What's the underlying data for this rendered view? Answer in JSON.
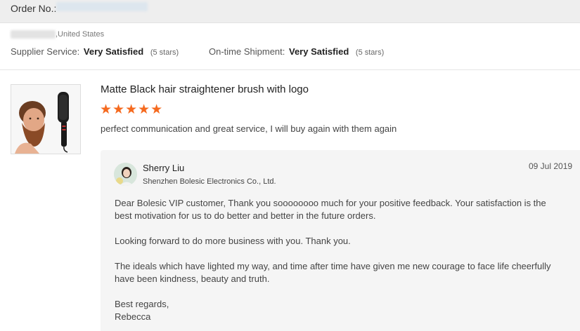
{
  "order": {
    "label": "Order No.:"
  },
  "buyer": {
    "country": ",United States"
  },
  "ratings": {
    "supplier_service": {
      "label": "Supplier Service:",
      "value": "Very Satisfied",
      "note": "(5 stars)"
    },
    "ontime_shipment": {
      "label": "On-time Shipment:",
      "value": "Very Satisfied",
      "note": "(5 stars)"
    }
  },
  "product": {
    "title": "Matte Black hair straightener brush with logo",
    "rating_stars": 5,
    "stars_text": "★★★★★",
    "feedback": "perfect communication and great service, I will buy again with them again",
    "thumbnail_icon": "man-with-hair-straightener-brush-image"
  },
  "reply": {
    "name": "Sherry Liu",
    "company": "Shenzhen Bolesic Electronics Co., Ltd.",
    "date": "09 Jul 2019",
    "avatar_icon": "avatar-photo",
    "paragraphs": [
      "Dear Bolesic VIP customer, Thank you soooooooo much for your positive feedback. Your satisfaction is the best motivation for us to do better and better in the future orders.",
      "Looking forward to do more business with you. Thank you.",
      "The ideals which have lighted my way, and time after time have given me new courage to face life cheerfully have been kindness, beauty and truth.",
      "Best regards,",
      "Rebecca"
    ]
  },
  "colors": {
    "star": "#f56a1f",
    "header_bg": "#eeeeee",
    "reply_bg": "#f5f5f5"
  }
}
